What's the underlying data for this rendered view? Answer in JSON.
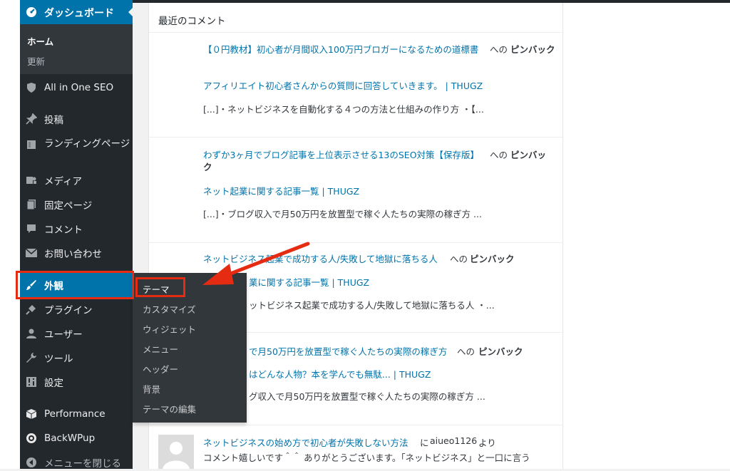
{
  "sidebar": {
    "dashboard_label": "ダッシュボード",
    "home_label": "ホーム",
    "updates_label": "更新",
    "items": [
      {
        "label": "All in One SEO",
        "icon": "shield-icon"
      },
      {
        "label": "投稿",
        "icon": "pin-icon"
      },
      {
        "label": "ランディングページ",
        "icon": "book-icon"
      },
      {
        "label": "メディア",
        "icon": "media-icon"
      },
      {
        "label": "固定ページ",
        "icon": "page-icon"
      },
      {
        "label": "コメント",
        "icon": "comment-icon"
      },
      {
        "label": "お問い合わせ",
        "icon": "mail-icon"
      },
      {
        "label": "外観",
        "icon": "brush-icon"
      },
      {
        "label": "プラグイン",
        "icon": "plug-icon"
      },
      {
        "label": "ユーザー",
        "icon": "user-icon"
      },
      {
        "label": "ツール",
        "icon": "wrench-icon"
      },
      {
        "label": "設定",
        "icon": "settings-icon"
      },
      {
        "label": "Performance",
        "icon": "cube-icon"
      },
      {
        "label": "BackWPup",
        "icon": "globe-icon"
      },
      {
        "label": "メニューを閉じる",
        "icon": "collapse-icon"
      }
    ]
  },
  "flyout": {
    "items": [
      "テーマ",
      "カスタマイズ",
      "ウィジェット",
      "メニュー",
      "ヘッダー",
      "背景",
      "テーマの編集"
    ]
  },
  "panel": {
    "title": "最近のコメント",
    "comments": [
      {
        "post": "【０円教材】初心者が月間収入100万円ブロガーになるための道標書",
        "to": "への",
        "type": "ピンバック",
        "type_cont": "",
        "source": "アフィリエイト初心者さんからの質問に回答していきます。 | THUGZ",
        "excerpt": "[...]・ネットビジネスを自動化する４つの方法と仕組みの作り方 ・【..."
      },
      {
        "post": "わずか3ヶ月でブログ記事を上位表示させる13のSEO対策【保存版】",
        "to": "への",
        "type": "ピンバッ",
        "type_cont": "ク",
        "source": "ネット起業に関する記事一覧 | THUGZ",
        "excerpt": "[...]・ブログ収入で月50万円を放置型で稼ぐ人たちの実際の稼ぎ方 ..."
      },
      {
        "post": "ネットビジネス起業で成功する人/失敗して地獄に落ちる人",
        "to": "への",
        "type": "ピンバック",
        "type_cont": "",
        "source": "業に関する記事一覧 | THUGZ",
        "excerpt": "ットビジネス起業で成功する人/失敗して地獄に落ちる人 ・..."
      },
      {
        "post": "で月50万円を放置型で稼ぐ人たちの実際の稼ぎ方",
        "to": "への",
        "type": "ピンバック",
        "type_cont": "",
        "source": "はどんな人物？本を学んでも無駄... | THUGZ",
        "excerpt": "グ収入で月50万円を放置型で稼ぐ人たちの実際の稼ぎ方 ..."
      },
      {
        "post": "ネットビジネスの始め方で初心者が失敗しない方法",
        "to": "に",
        "type": "aiueo1126",
        "type_cont": "より",
        "source": "",
        "excerpt": "コメント嬉しいです＾＾ ありがとうございます。「ネットビジネス」と一口に言う"
      }
    ]
  },
  "colors": {
    "sidebar_bg": "#23282d",
    "submenu_bg": "#32373c",
    "accent": "#0073aa",
    "highlight": "#e62b13"
  }
}
